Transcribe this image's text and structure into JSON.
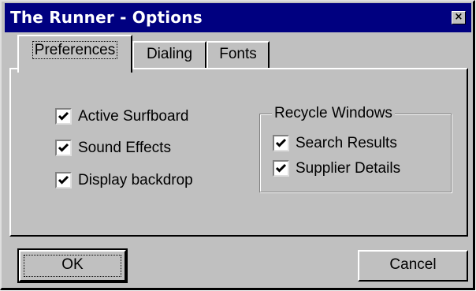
{
  "window": {
    "title": "The Runner - Options",
    "close_glyph": "×"
  },
  "tabs": [
    {
      "label": "Preferences",
      "active": true
    },
    {
      "label": "Dialing",
      "active": false
    },
    {
      "label": "Fonts",
      "active": false
    }
  ],
  "preferences": {
    "options": [
      {
        "label": "Active Surfboard",
        "checked": true
      },
      {
        "label": "Sound Effects",
        "checked": true
      },
      {
        "label": "Display backdrop",
        "checked": true
      }
    ],
    "recycle_group": {
      "title": "Recycle Windows",
      "options": [
        {
          "label": "Search Results",
          "checked": true
        },
        {
          "label": "Supplier Details",
          "checked": true
        }
      ]
    }
  },
  "buttons": {
    "ok_label": "OK",
    "cancel_label": "Cancel"
  },
  "colors": {
    "titlebar": "#000080",
    "face": "#c0c0c0"
  }
}
